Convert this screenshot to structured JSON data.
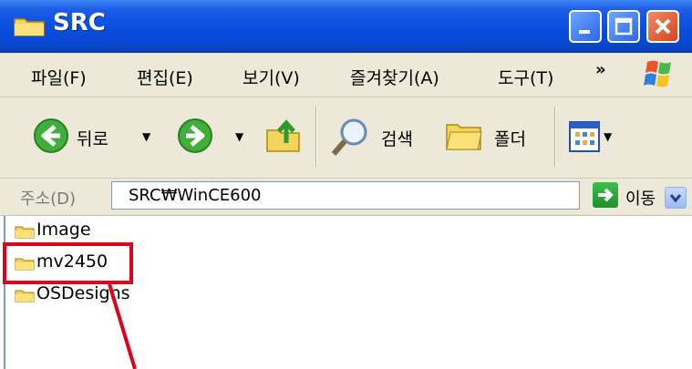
{
  "window": {
    "title": "SRC",
    "folder_icon": "folder-icon"
  },
  "title_buttons": {
    "minimize": "minimize-icon",
    "maximize": "maximize-icon",
    "close": "close-icon"
  },
  "menu": {
    "items": [
      "파일(F)",
      "편집(E)",
      "보기(V)",
      "즐겨찾기(A)",
      "도구(T)"
    ],
    "overflow": "»"
  },
  "toolbar": {
    "back_label": "뒤로",
    "search_label": "검색",
    "folders_label": "폴더"
  },
  "address": {
    "label": "주소(D)",
    "value": "SRC₩WinCE600",
    "go_label": "이동"
  },
  "files": [
    {
      "name": "Image"
    },
    {
      "name": "mv2450"
    },
    {
      "name": "OSDesigns"
    }
  ],
  "colors": {
    "titlebar": "#0a4fe0",
    "chrome": "#ece9d8",
    "highlight": "#e0001b"
  }
}
